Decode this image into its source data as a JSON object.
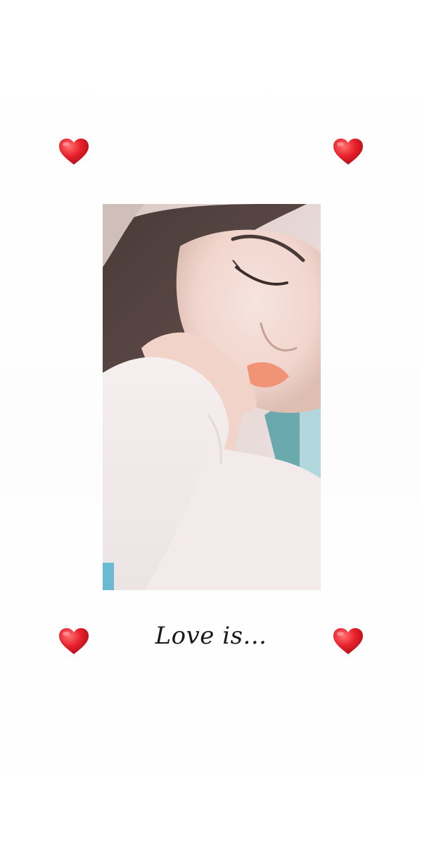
{
  "caption": {
    "text": "Love is..."
  },
  "decorations": {
    "heart_icon": "heart-icon",
    "heart_color": "#e0202a",
    "heart_highlight": "#ff6a6a"
  },
  "photo": {
    "subject": "selfie-photo"
  },
  "background_color": "#ffffff"
}
